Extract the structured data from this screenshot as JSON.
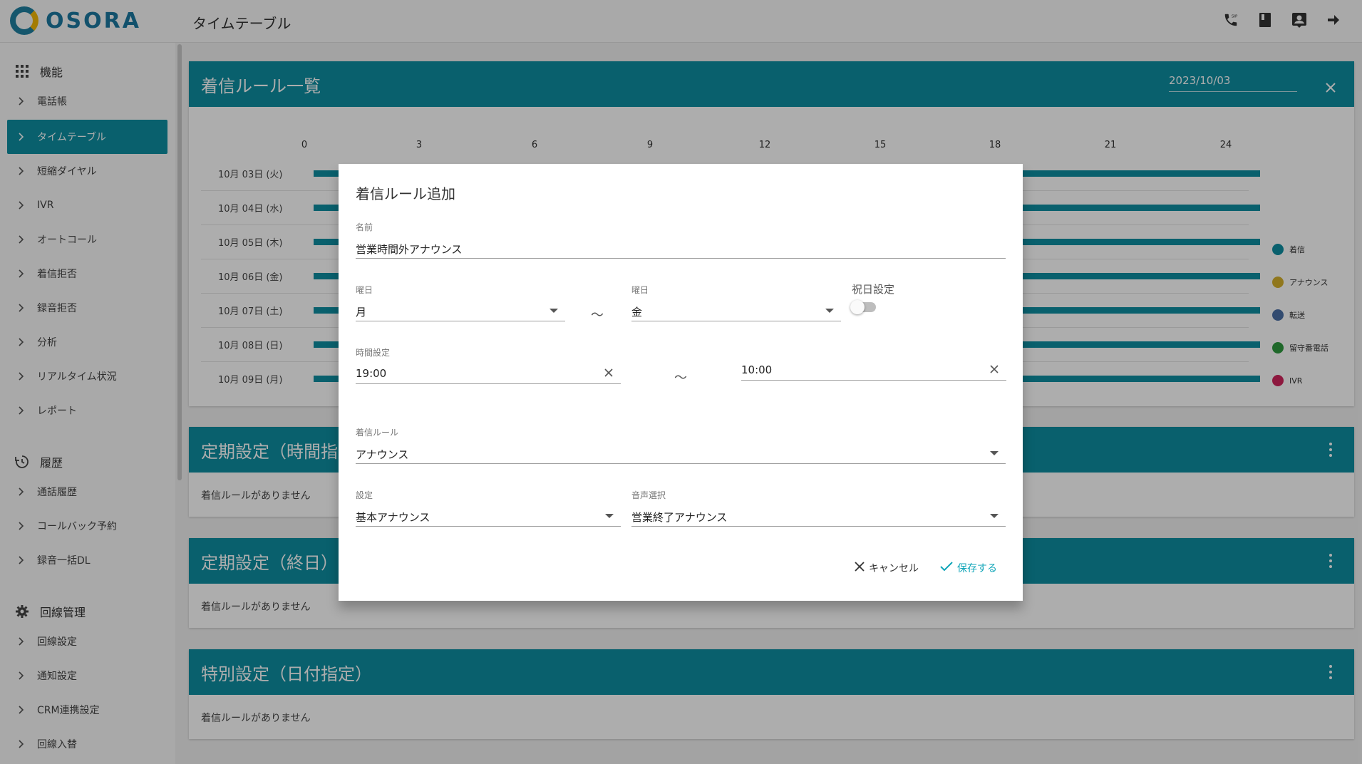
{
  "header": {
    "logo_text": "OSORA",
    "page_title": "タイムテーブル",
    "icons": [
      "sip-phone-icon",
      "book-icon",
      "contact-icon",
      "logout-arrow-icon"
    ]
  },
  "sidebar": {
    "sections": [
      {
        "title": "機能",
        "icon": "grid-icon"
      },
      {
        "title": "履歴",
        "icon": "history-icon"
      },
      {
        "title": "回線管理",
        "icon": "gear-icon"
      }
    ],
    "features": [
      "電話帳",
      "タイムテーブル",
      "短縮ダイヤル",
      "IVR",
      "オートコール",
      "着信拒否",
      "録音拒否",
      "分析",
      "リアルタイム状況",
      "レポート"
    ],
    "history": [
      "通話履歴",
      "コールバック予約",
      "録音一括DL"
    ],
    "line_mgmt": [
      "回線設定",
      "通知設定",
      "CRM連携設定",
      "回線入替"
    ],
    "active": "タイムテーブル"
  },
  "rules_card": {
    "title": "着信ルール一覧",
    "date": "2023/10/03",
    "hours": [
      "0",
      "3",
      "6",
      "9",
      "12",
      "15",
      "18",
      "21",
      "24"
    ],
    "days": [
      "10月 03日 (火)",
      "10月 04日 (水)",
      "10月 05日 (木)",
      "10月 06日 (金)",
      "10月 07日 (土)",
      "10月 08日 (日)",
      "10月 09日 (月)"
    ],
    "legend": [
      {
        "label": "着信",
        "color": "#0e8ea1"
      },
      {
        "label": "アナウンス",
        "color": "#d4b02c"
      },
      {
        "label": "転送",
        "color": "#4a6fa5"
      },
      {
        "label": "留守番電話",
        "color": "#2e9a3f"
      },
      {
        "label": "IVR",
        "color": "#d0245c"
      }
    ]
  },
  "periodic_time": {
    "title": "定期設定（時間指定）",
    "empty": "着信ルールがありません"
  },
  "periodic_all": {
    "title": "定期設定（終日）",
    "empty": "着信ルールがありません"
  },
  "special": {
    "title": "特別設定（日付指定）",
    "empty": "着信ルールがありません"
  },
  "dialog": {
    "title": "着信ルール追加",
    "name_label": "名前",
    "name_value": "営業時間外アナウンス",
    "day_from_label": "曜日",
    "day_from": "月",
    "day_to_label": "曜日",
    "day_to": "金",
    "tilde": "〜",
    "holiday_label": "祝日設定",
    "holiday_on": false,
    "time_label": "時間設定",
    "time_from": "19:00",
    "time_to": "10:00",
    "rule_label": "着信ルール",
    "rule_value": "アナウンス",
    "setting_label": "設定",
    "setting_value": "基本アナウンス",
    "voice_label": "音声選択",
    "voice_value": "営業終了アナウンス",
    "cancel_label": "キャンセル",
    "save_label": "保存する"
  }
}
